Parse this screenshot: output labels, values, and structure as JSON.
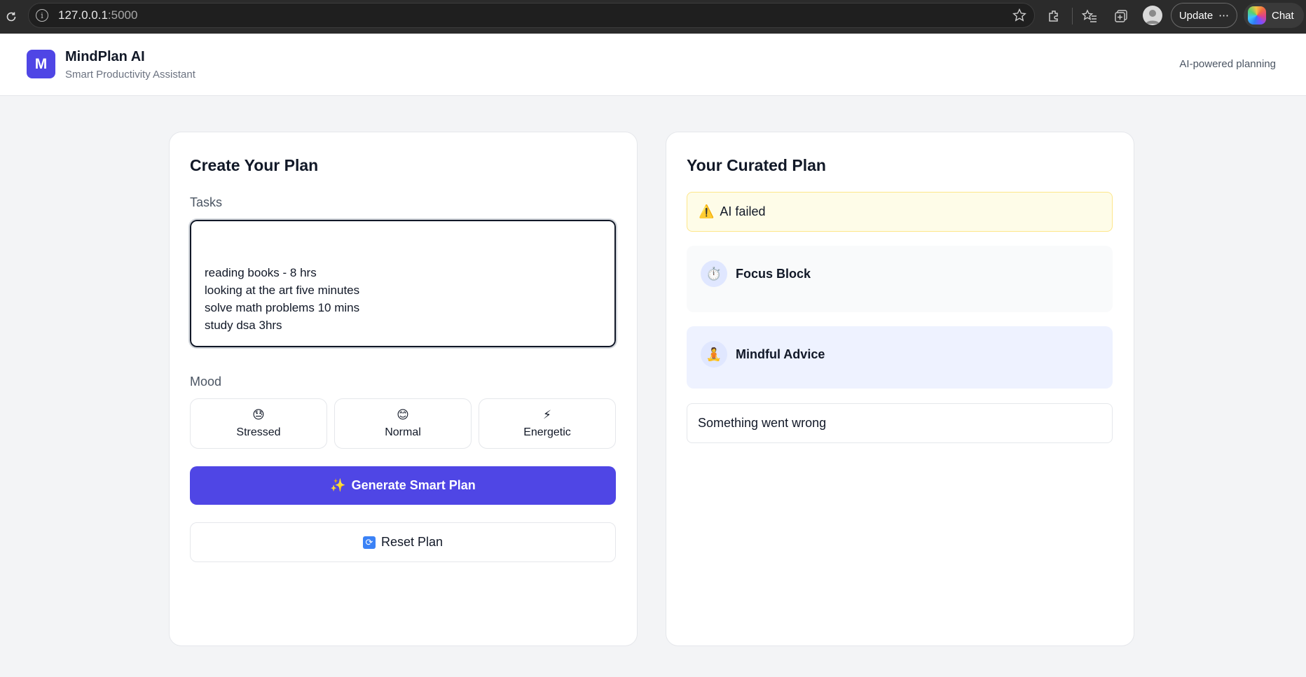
{
  "browser": {
    "url_host": "127.0.0.1",
    "url_port": ":5000",
    "update_label": "Update",
    "chat_label": "Chat"
  },
  "header": {
    "logo_letter": "M",
    "app_name": "MindPlan AI",
    "subtitle": "Smart Productivity Assistant",
    "right_text": "AI-powered planning"
  },
  "create_plan": {
    "title": "Create Your Plan",
    "tasks_label": "Tasks",
    "tasks_value": "\nreading books - 8 hrs\nlooking at the art five minutes\nsolve math problems 10 mins\nstudy dsa 3hrs",
    "mood_label": "Mood",
    "moods": [
      {
        "emoji": "😓",
        "label": "Stressed"
      },
      {
        "emoji": "😊",
        "label": "Normal"
      },
      {
        "emoji": "⚡",
        "label": "Energetic"
      }
    ],
    "generate_icon": "✨",
    "generate_label": "Generate Smart Plan",
    "reset_label": "Reset Plan"
  },
  "curated_plan": {
    "title": "Your Curated Plan",
    "alert_icon": "⚠️",
    "alert_text": "AI failed",
    "focus_icon": "⏱️",
    "focus_title": "Focus Block",
    "mindful_icon": "🧘",
    "mindful_title": "Mindful Advice",
    "error_text": "Something went wrong"
  },
  "colors": {
    "accent": "#4f46e5",
    "alert_bg": "#fefce8",
    "mindful_bg": "#eef2ff"
  }
}
